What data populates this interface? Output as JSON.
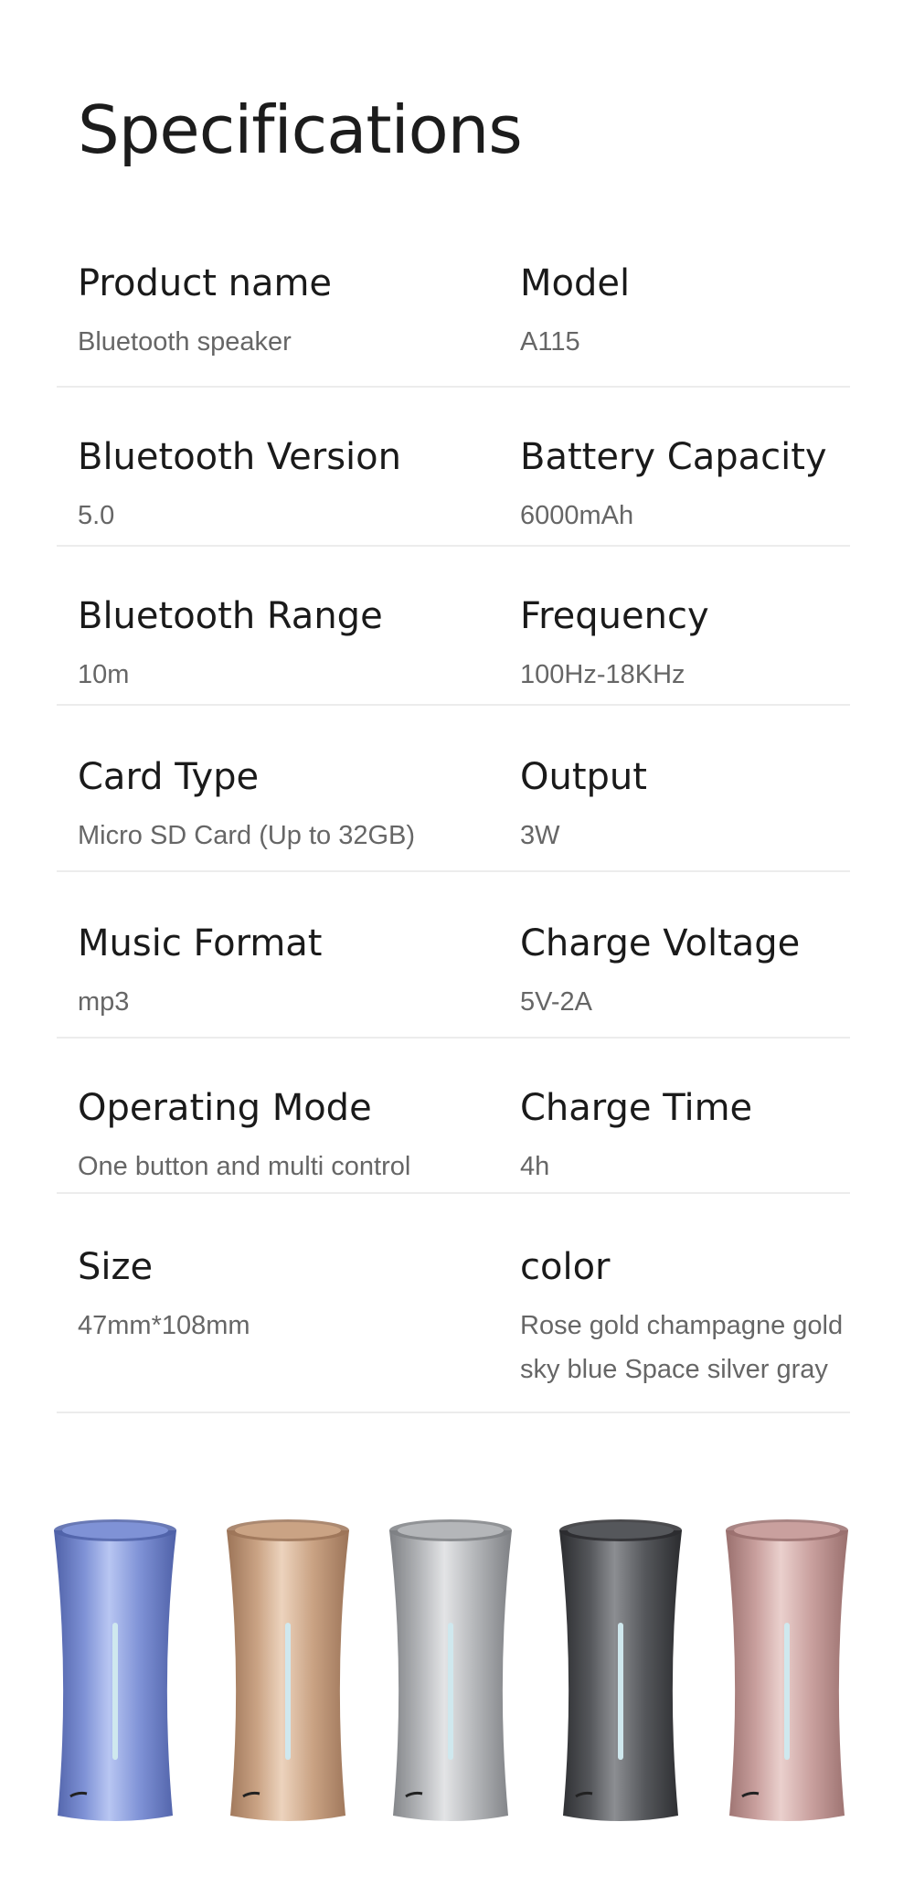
{
  "page": {
    "title": "Specifications"
  },
  "specs": [
    {
      "left": {
        "label": "Product name",
        "value": "Bluetooth speaker"
      },
      "right": {
        "label": "Model",
        "value": "A115"
      }
    },
    {
      "left": {
        "label": "Bluetooth Version",
        "value": "5.0"
      },
      "right": {
        "label": "Battery Capacity",
        "value": "6000mAh"
      }
    },
    {
      "left": {
        "label": "Bluetooth Range",
        "value": "10m"
      },
      "right": {
        "label": "Frequency",
        "value": "100Hz-18KHz"
      }
    },
    {
      "left": {
        "label": "Card Type",
        "value": "Micro SD Card (Up to 32GB)"
      },
      "right": {
        "label": "Output",
        "value": "3W"
      }
    },
    {
      "left": {
        "label": "Music Format",
        "value": "mp3"
      },
      "right": {
        "label": "Charge Voltage",
        "value": "5V-2A"
      }
    },
    {
      "left": {
        "label": "Operating Mode",
        "value": "One button and multi control"
      },
      "right": {
        "label": "Charge Time",
        "value": "4h"
      }
    },
    {
      "left": {
        "label": "Size",
        "value": "47mm*108mm"
      },
      "right": {
        "label": "color",
        "value": "Rose gold  champagne gold",
        "value2": "sky blue  Space silver  gray"
      }
    }
  ],
  "products": [
    {
      "name": "sky-blue-speaker",
      "color": "#7f92d6",
      "light": "#b8c6f2",
      "dark": "#4f61a8"
    },
    {
      "name": "champagne-gold-speaker",
      "color": "#caa384",
      "light": "#ecd3bd",
      "dark": "#9c7458"
    },
    {
      "name": "space-silver-speaker",
      "color": "#b4b6b9",
      "light": "#e3e4e6",
      "dark": "#7e8084"
    },
    {
      "name": "gray-speaker",
      "color": "#55575b",
      "light": "#8c8e92",
      "dark": "#2b2c2f"
    },
    {
      "name": "rose-gold-speaker",
      "color": "#c9a09e",
      "light": "#ead0cd",
      "dark": "#9a706e"
    }
  ]
}
